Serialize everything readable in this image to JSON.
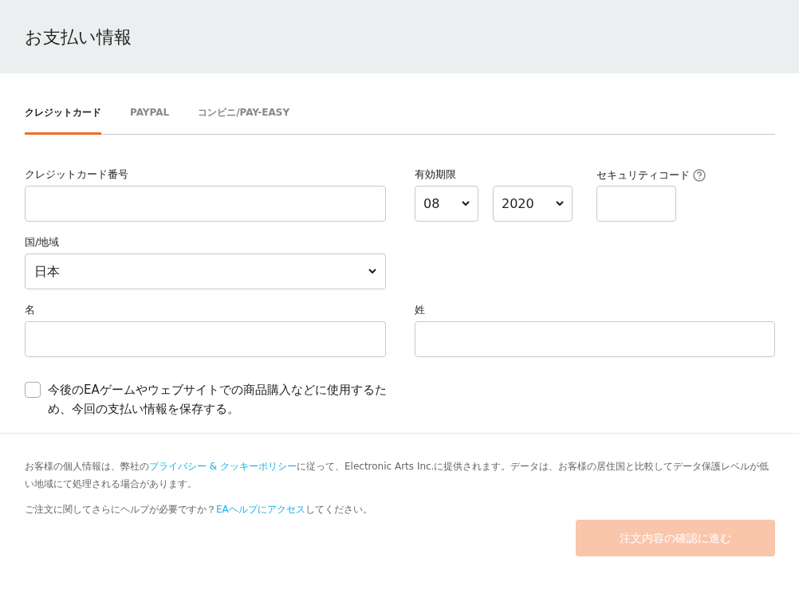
{
  "dialog": {
    "title": "お支払い情報"
  },
  "tabs": [
    {
      "label": "クレジットカード",
      "selected": true
    },
    {
      "label": "PAYPAL",
      "selected": false
    },
    {
      "label": "コンビニ/PAY-EASY",
      "selected": false
    }
  ],
  "card_number": {
    "label": "クレジットカード番号"
  },
  "expiry": {
    "label": "有効期限",
    "month": "08",
    "year": "2020"
  },
  "security_code": {
    "label": "セキュリティコード"
  },
  "country": {
    "label": "国/地域",
    "value": "日本"
  },
  "first_name": {
    "label": "名"
  },
  "last_name": {
    "label": "姓"
  },
  "save_option": {
    "label": "今後のEAゲームやウェブサイトでの商品購入などに使用するため、今回の支払い情報を保存する。",
    "checked": false
  },
  "notices": [
    [
      {
        "text": "お客様の個人情報は、弊社の",
        "link": false
      },
      {
        "text": "プライバシー & クッキーポリシー",
        "link": true
      },
      {
        "text": "に従って、Electronic Arts Inc.に提供されます。データは、お客様の居住国と比較してデータ保護レベルが低い地域にて処理される場合があります。",
        "link": false
      }
    ],
    [
      {
        "text": "ご注文に関してさらにヘルプが必要ですか？",
        "link": false
      },
      {
        "text": "EAヘルプにアクセス",
        "link": true
      },
      {
        "text": "してください。",
        "link": false
      }
    ]
  ],
  "submit": {
    "label": "注文内容の確認に進む",
    "disabled": true
  }
}
